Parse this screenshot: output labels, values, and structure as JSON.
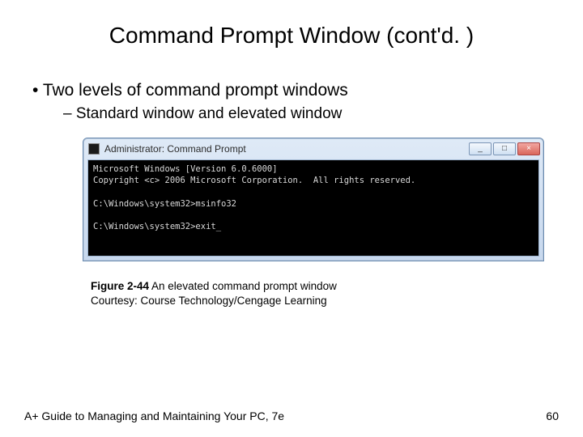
{
  "title": "Command Prompt Window (cont'd. )",
  "bullets": {
    "l1": "Two levels of command prompt windows",
    "l2": "Standard window and elevated window"
  },
  "cmd": {
    "window_title": "Administrator: Command Prompt",
    "btn_min": "_",
    "btn_max": "□",
    "btn_close": "×",
    "line_ver": "Microsoft Windows [Version 6.0.6000]",
    "line_copy": "Copyright <c> 2006 Microsoft Corporation.  All rights reserved.",
    "line_blank1": "",
    "line_prompt1": "C:\\Windows\\system32>msinfo32",
    "line_blank2": "",
    "line_prompt2": "C:\\Windows\\system32>exit_"
  },
  "caption": {
    "fig_label": "Figure 2-44",
    "fig_text": " An elevated command prompt window",
    "courtesy": "Courtesy: Course Technology/Cengage Learning"
  },
  "footer": {
    "left": "A+ Guide to Managing and Maintaining Your PC, 7e",
    "right": "60"
  }
}
